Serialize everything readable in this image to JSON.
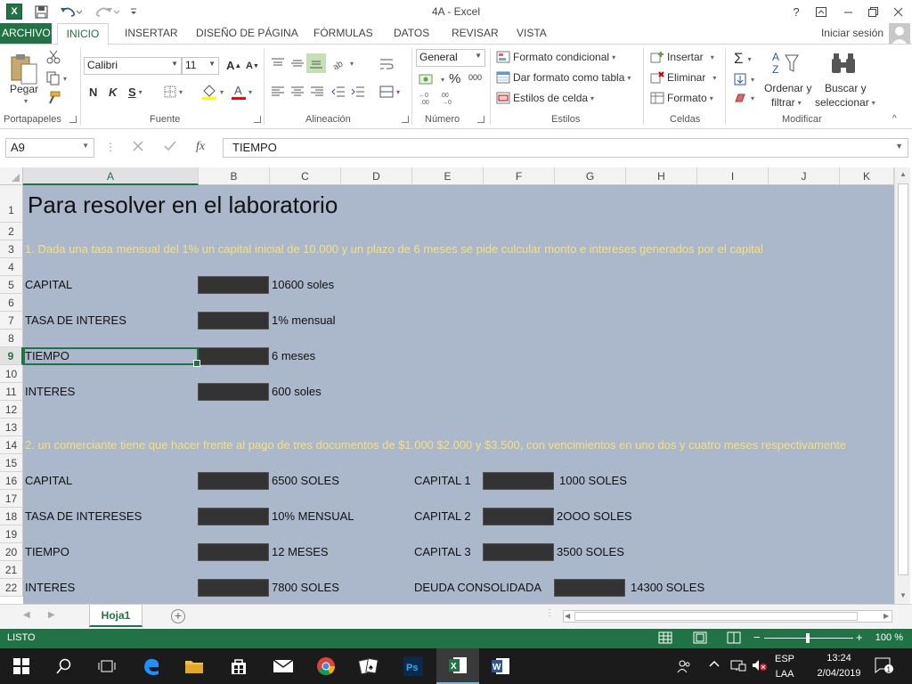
{
  "window": {
    "title": "4A - Excel",
    "app_badge": "X"
  },
  "tabs": [
    {
      "label": "ARCHIVO"
    },
    {
      "label": "INICIO"
    },
    {
      "label": "INSERTAR"
    },
    {
      "label": "DISEÑO DE PÁGINA"
    },
    {
      "label": "FÓRMULAS"
    },
    {
      "label": "DATOS"
    },
    {
      "label": "REVISAR"
    },
    {
      "label": "VISTA"
    }
  ],
  "signin": "Iniciar sesión",
  "ribbon": {
    "clipboard": {
      "paste": "Pegar",
      "label": "Portapapeles"
    },
    "font": {
      "name": "Calibri",
      "size": "11",
      "bold": "N",
      "italic": "K",
      "underline": "S",
      "label": "Fuente"
    },
    "alignment": {
      "label": "Alineación"
    },
    "number": {
      "format": "General",
      "label": "Número"
    },
    "styles": {
      "conditional": "Formato condicional",
      "table": "Dar formato como tabla",
      "cell": "Estilos de celda",
      "label": "Estilos"
    },
    "cells": {
      "insert": "Insertar",
      "delete": "Eliminar",
      "format": "Formato",
      "label": "Celdas"
    },
    "editing": {
      "sort1": "Ordenar y",
      "sort2": "filtrar",
      "find1": "Buscar y",
      "find2": "seleccionar",
      "label": "Modificar"
    }
  },
  "formula_bar": {
    "name_box": "A9",
    "formula": "TIEMPO"
  },
  "columns": [
    "A",
    "B",
    "C",
    "D",
    "E",
    "F",
    "G",
    "H",
    "I",
    "J",
    "K"
  ],
  "rows": [
    "1",
    "2",
    "3",
    "4",
    "5",
    "6",
    "7",
    "8",
    "9",
    "10",
    "11",
    "12",
    "13",
    "14",
    "15",
    "16",
    "17",
    "18",
    "19",
    "20",
    "21",
    "22"
  ],
  "cells": {
    "title": "Para resolver en el laboratorio",
    "problem1": "1.  Dada una tasa mensual del 1% un capital inicial de 10.000 y un plazo de 6 meses  se pide culcular monto e intereses generados por el capital",
    "p1_capital_label": "CAPITAL",
    "p1_capital_value": "10600 soles",
    "p1_tasa_label": "TASA DE INTERES",
    "p1_tasa_value": "1% mensual",
    "p1_tiempo_label": "TIEMPO",
    "p1_tiempo_value": "6 meses",
    "p1_interes_label": "INTERES",
    "p1_interes_value": "600 soles",
    "problem2": "2. un comerciante tiene que hacer frente al pago de tres documentos de $1.000 $2.000 y $3.500,  con vencimientos en uno dos y cuatro meses respectivamente",
    "p2_capital_label": "CAPITAL",
    "p2_capital_value": "6500 SOLES",
    "p2_tasa_label": "TASA DE INTERESES",
    "p2_tasa_value": "10% MENSUAL",
    "p2_tiempo_label": "TIEMPO",
    "p2_tiempo_value": "12 MESES",
    "p2_interes_label": "INTERES",
    "p2_interes_value": "7800 SOLES",
    "c1_label": "CAPITAL 1",
    "c1_value": "1000 SOLES",
    "c2_label": "CAPITAL 2",
    "c2_value": "2OOO SOLES",
    "c3_label": "CAPITAL 3",
    "c3_value": "3500 SOLES",
    "deuda_label": "DEUDA CONSOLIDADA",
    "deuda_value": "14300 SOLES"
  },
  "sheet_tab": "Hoja1",
  "status": {
    "text": "LISTO",
    "zoom": "100 %"
  },
  "taskbar": {
    "lang1": "ESP",
    "lang2": "LAA",
    "time": "13:24",
    "date": "2/04/2019",
    "notif": "1"
  },
  "colors": {
    "excel_green": "#217346",
    "sheet_fill": "#abb8cb",
    "note_text": "#f5e07a",
    "redacted": "#333333"
  }
}
